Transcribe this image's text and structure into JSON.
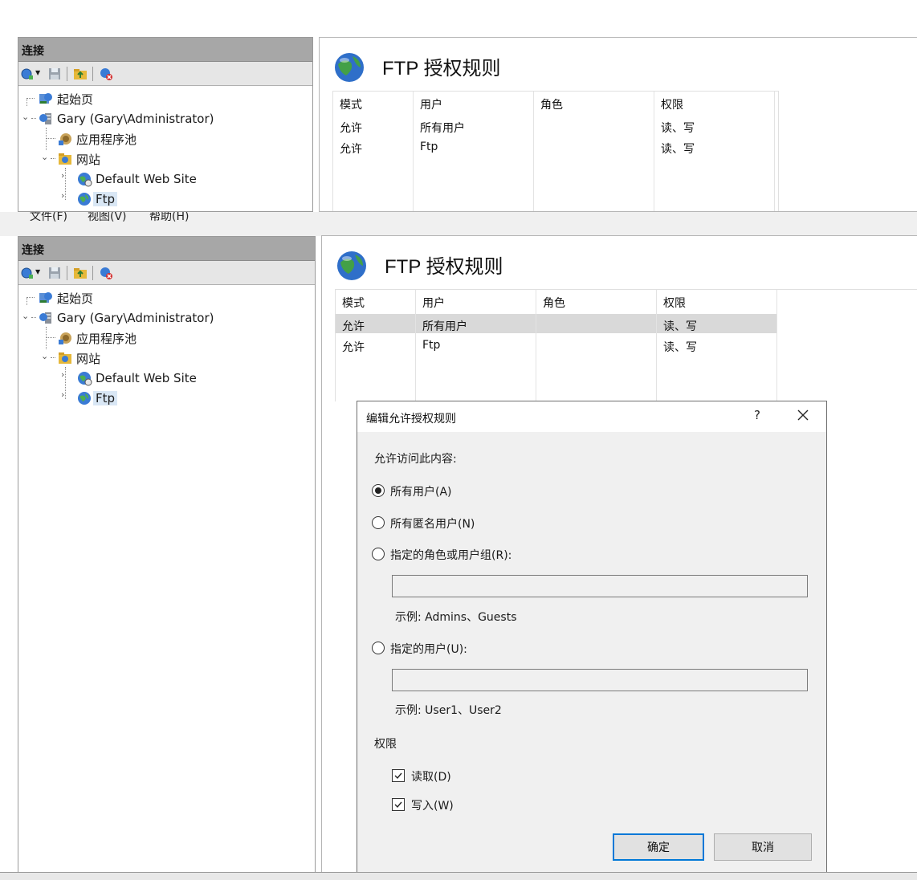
{
  "connections": {
    "header": "连接",
    "tree": {
      "start_page": "起始页",
      "server": "Gary (Gary\\Administrator)",
      "app_pools": "应用程序池",
      "sites": "网站",
      "default_site": "Default Web Site",
      "ftp_site": "Ftp"
    }
  },
  "menu": {
    "file": "文件(F)",
    "view": "视图(V)",
    "help": "帮助(H)"
  },
  "feature": {
    "title": "FTP 授权规则",
    "columns": [
      "模式",
      "用户",
      "角色",
      "权限"
    ],
    "rows": [
      {
        "mode": "允许",
        "user": "所有用户",
        "role": "",
        "perm": "读、写"
      },
      {
        "mode": "允许",
        "user": "Ftp",
        "role": "",
        "perm": "读、写"
      }
    ]
  },
  "dialog": {
    "title": "编辑允许授权规则",
    "help": "?",
    "access_label": "允许访问此内容:",
    "options": {
      "all_users": "所有用户(A)",
      "anonymous": "所有匿名用户(N)",
      "roles": "指定的角色或用户组(R):",
      "users": "指定的用户(U):"
    },
    "selected_option": "all_users",
    "roles_value": "",
    "roles_example": "示例: Admins、Guests",
    "users_value": "",
    "users_example": "示例: User1、User2",
    "permissions_label": "权限",
    "read_label": "读取(D)",
    "read_checked": true,
    "write_label": "写入(W)",
    "write_checked": true,
    "ok_button": "确定",
    "cancel_button": "取消"
  },
  "colors": {
    "header_gray": "#a7a7a7",
    "selection": "#d9d9d9",
    "dialog_bg": "#f0f0f0",
    "accent": "#0078d7"
  }
}
